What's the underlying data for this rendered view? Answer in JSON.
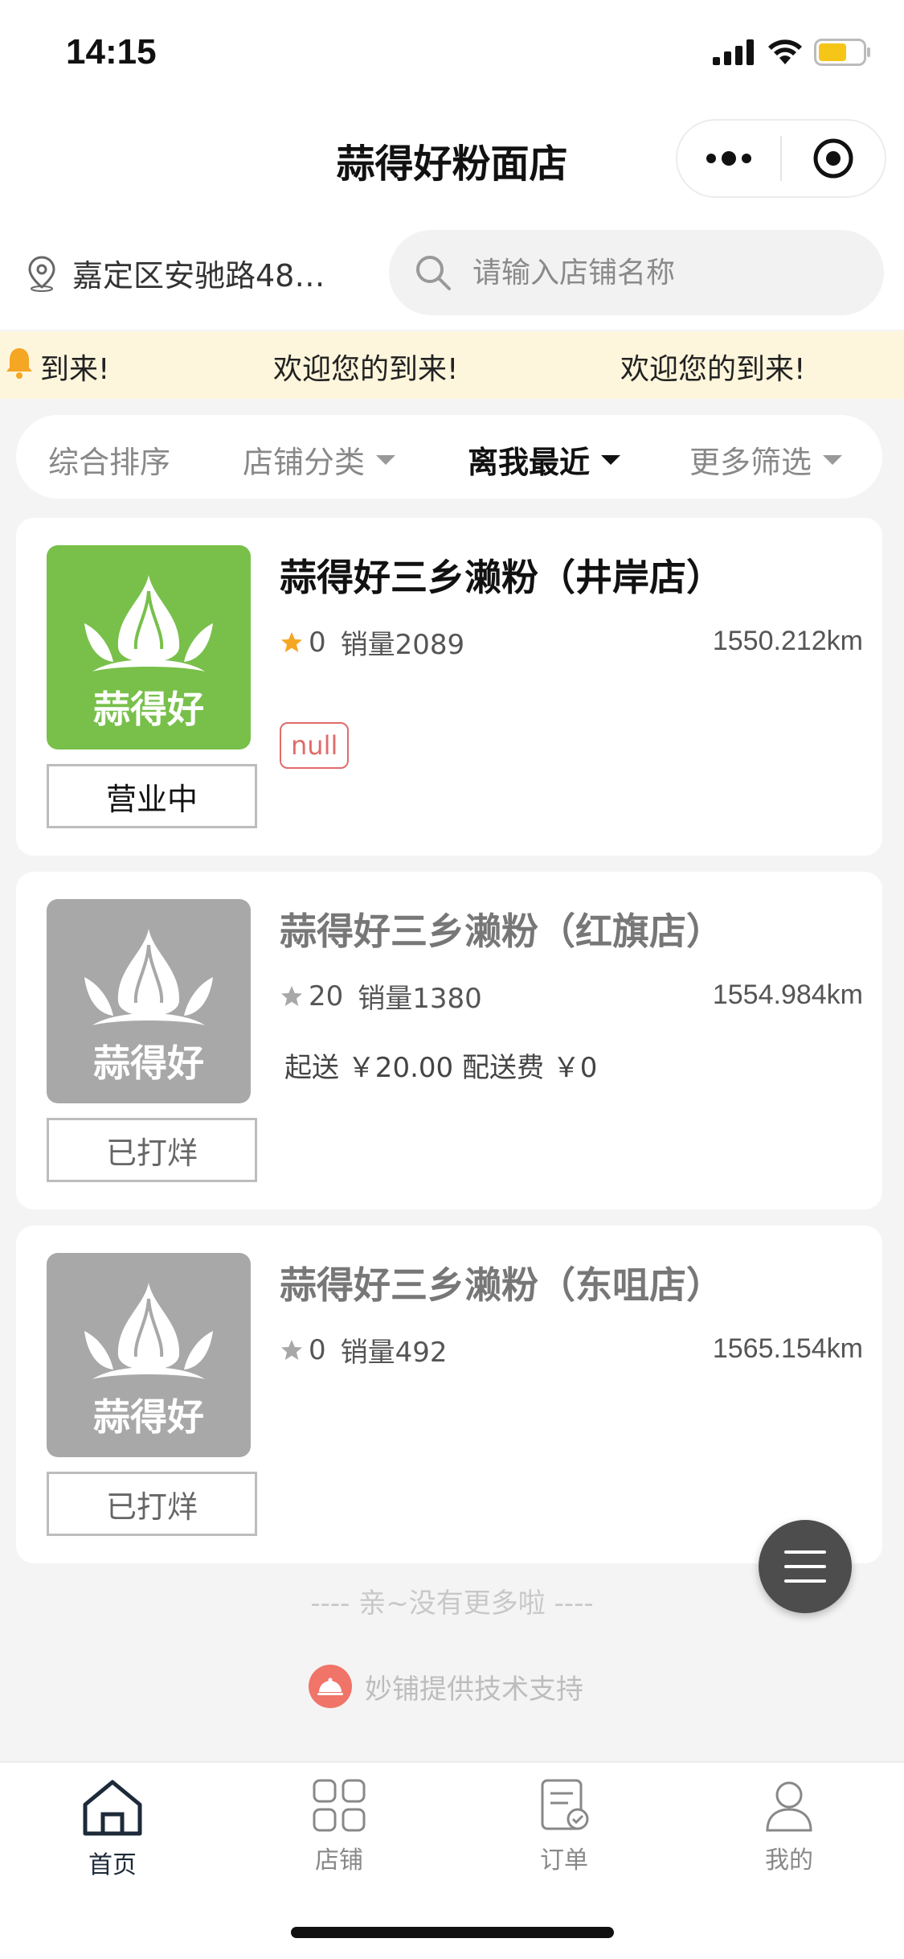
{
  "status_bar": {
    "time": "14:15"
  },
  "nav": {
    "title": "蒜得好粉面店"
  },
  "location": {
    "address": "嘉定区安驰路48…"
  },
  "search": {
    "placeholder": "请输入店铺名称"
  },
  "notice": {
    "items": [
      "到来!",
      "欢迎您的到来!",
      "欢迎您的到来!"
    ]
  },
  "filters": {
    "items": [
      {
        "label": "综合排序",
        "has_arrow": false,
        "active": false
      },
      {
        "label": "店铺分类",
        "has_arrow": true,
        "active": false
      },
      {
        "label": "离我最近",
        "has_arrow": true,
        "active": true
      },
      {
        "label": "更多筛选",
        "has_arrow": true,
        "active": false
      }
    ]
  },
  "shops": [
    {
      "name": "蒜得好三乡濑粉（井岸店）",
      "logo_text": "蒜得好",
      "rating": "0",
      "sales": "销量2089",
      "distance": "1550.212km",
      "tag": "null",
      "delivery": "",
      "status": "营业中",
      "open": true
    },
    {
      "name": "蒜得好三乡濑粉（红旗店）",
      "logo_text": "蒜得好",
      "rating": "20",
      "sales": "销量1380",
      "distance": "1554.984km",
      "tag": "",
      "delivery": "起送 ￥20.00  配送费 ￥0",
      "status": "已打烊",
      "open": false
    },
    {
      "name": "蒜得好三乡濑粉（东咀店）",
      "logo_text": "蒜得好",
      "rating": "0",
      "sales": "销量492",
      "distance": "1565.154km",
      "tag": "",
      "delivery": "",
      "status": "已打烊",
      "open": false
    }
  ],
  "footer": {
    "no_more": "---- 亲~没有更多啦 ----",
    "support": "妙铺提供技术支持"
  },
  "tabs": [
    {
      "label": "首页",
      "icon": "home-icon",
      "active": true
    },
    {
      "label": "店铺",
      "icon": "grid-icon",
      "active": false
    },
    {
      "label": "订单",
      "icon": "order-icon",
      "active": false
    },
    {
      "label": "我的",
      "icon": "user-icon",
      "active": false
    }
  ],
  "colors": {
    "brand_green": "#78c04a",
    "closed_grey": "#a8a8a8",
    "notice_bg": "#fdf6dc",
    "star": "#f5a623",
    "tag_red": "#e06b6b"
  }
}
